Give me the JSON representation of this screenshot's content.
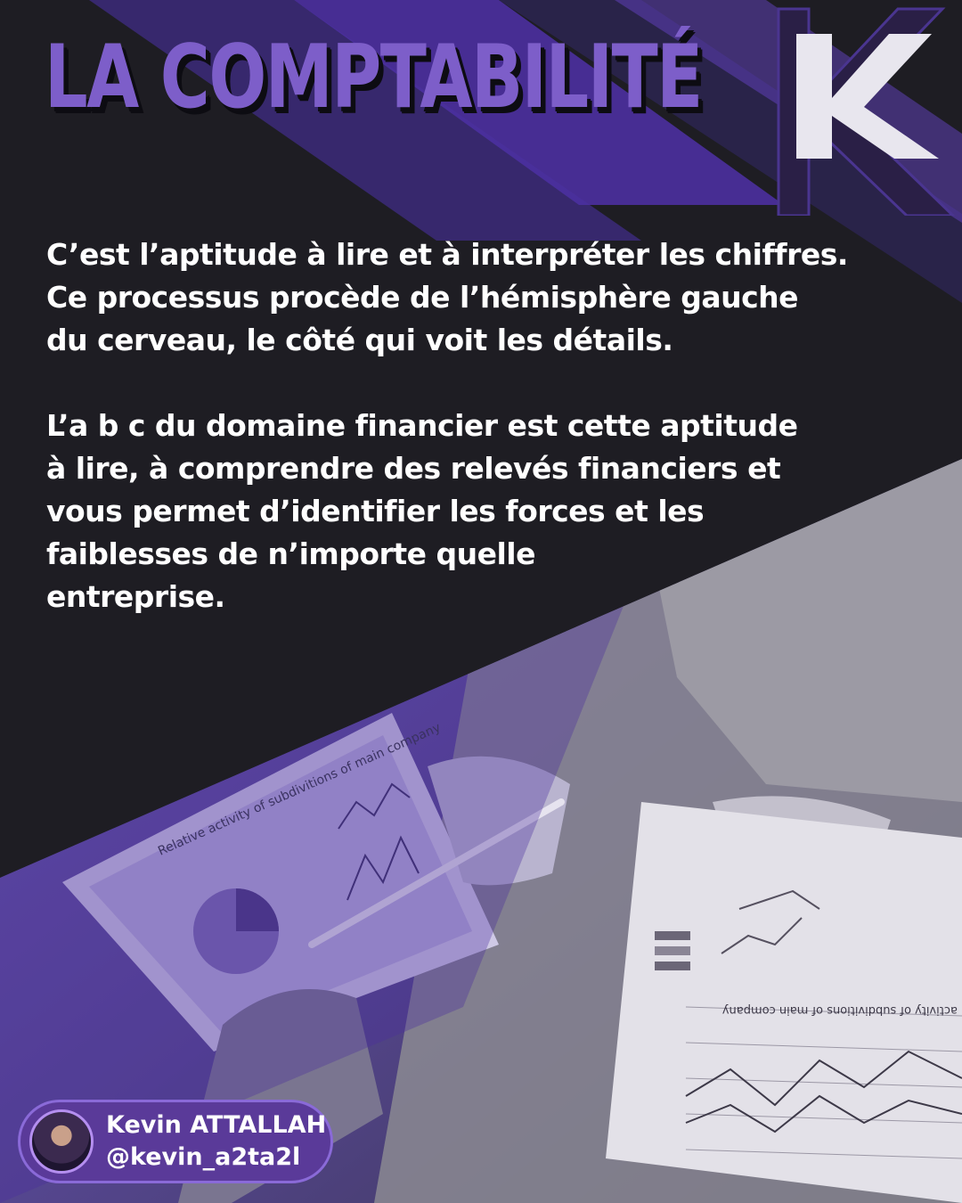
{
  "header": {
    "title": "LA COMPTABILITÉ",
    "logo_letter": "K"
  },
  "content": {
    "paragraph_1": "C’est l’aptitude à lire et à interpréter les chiffres.\nCe processus procède de l’hémisphère gauche\ndu cerveau, le côté qui voit les détails.",
    "paragraph_2": "L’a b c du domaine financier est cette aptitude\nà lire, à comprendre des relevés financiers et\nvous permet d’identifier les forces et les\nfaiblesses de n’importe quelle\nentreprise."
  },
  "photo": {
    "icon": "business-charts-photo",
    "chart_caption": "Relative activity of subdivitions of main company",
    "chart_caption_2": "activity of subdivitions of main company"
  },
  "author": {
    "name": "Kevin ATTALLAH",
    "handle": "@kevin_a2ta2l",
    "icon": "avatar"
  },
  "colors": {
    "background": "#1e1d23",
    "accent_purple": "#7d5ec9",
    "deep_purple": "#3d2585",
    "text": "#ffffff"
  }
}
